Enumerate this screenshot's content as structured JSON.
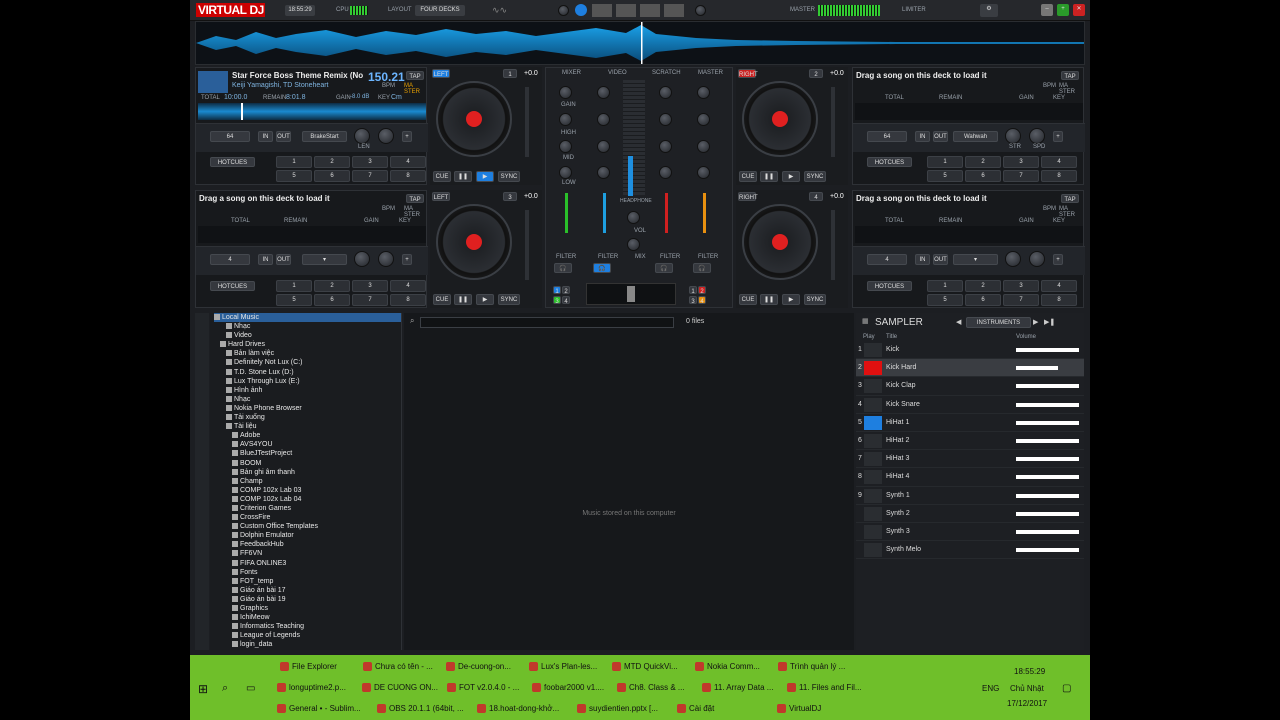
{
  "app": {
    "logo_a": "VIRTUAL",
    "logo_b": "DJ",
    "clock": "18:55:29",
    "cpu_label": "CPU",
    "layout_label": "LAYOUT",
    "layout_value": "FOUR DECKS",
    "master_label": "MASTER",
    "limiter_label": "LIMITER"
  },
  "deck1": {
    "title": "Star Force Boss Theme Remix (No",
    "artist": "Keiji Yamagishi, TD Stoneheart",
    "bpm": "150.21",
    "bpm_label": "BPM",
    "total_label": "TOTAL",
    "total": "10:00.0",
    "remain_label": "REMAIN",
    "remain": "8:01.8",
    "gain_label": "GAIN",
    "gain": "-8.0 dB",
    "key_label": "KEY",
    "key": "Cm",
    "tap": "TAP",
    "master": "MA STER",
    "loop": "64",
    "fx": "BrakeStart",
    "len": "LEN",
    "hotcues": "HOTCUES",
    "side": "LEFT",
    "num": "1",
    "pitch": "+0.0"
  },
  "deck2": {
    "title": "Drag a song on this deck to load it",
    "tap": "TAP",
    "bpm_label": "BPM",
    "master": "MA STER",
    "total_label": "TOTAL",
    "remain_label": "REMAIN",
    "gain_label": "GAIN",
    "key_label": "KEY",
    "loop": "64",
    "fx": "Wahwah",
    "str": "STR",
    "spd": "SPD",
    "hotcues": "HOTCUES",
    "side": "RIGHT",
    "num": "2",
    "pitch": "+0.0"
  },
  "deck3": {
    "title": "Drag a song on this deck to load it",
    "tap": "TAP",
    "bpm_label": "BPM",
    "master": "MA STER",
    "total_label": "TOTAL",
    "remain_label": "REMAIN",
    "gain_label": "GAIN",
    "key_label": "KEY",
    "loop": "4",
    "hotcues": "HOTCUES",
    "side": "LEFT",
    "num": "3",
    "pitch": "+0.0"
  },
  "deck4": {
    "title": "Drag a song on this deck to load it",
    "tap": "TAP",
    "bpm_label": "BPM",
    "master": "MA STER",
    "total_label": "TOTAL",
    "remain_label": "REMAIN",
    "gain_label": "GAIN",
    "key_label": "KEY",
    "loop": "4",
    "hotcues": "HOTCUES",
    "side": "RIGHT",
    "num": "4",
    "pitch": "+0.0"
  },
  "transport": {
    "cue": "CUE",
    "sync": "SYNC",
    "in": "IN",
    "out": "OUT",
    "loop": "LOOP",
    "pads": "PADS",
    "pct": "100%"
  },
  "pads": [
    "1",
    "2",
    "3",
    "4",
    "5",
    "6",
    "7",
    "8"
  ],
  "mixer": {
    "tabs": [
      "MIXER",
      "VIDEO",
      "SCRATCH",
      "MASTER"
    ],
    "gain": "GAIN",
    "high": "HIGH",
    "mid": "MID",
    "low": "LOW",
    "filter": "FILTER",
    "headphone": "HEADPHONE",
    "vol": "VOL",
    "mix": "MIX"
  },
  "browser": {
    "files": "0 files",
    "empty": "Music stored on this computer",
    "tree": [
      "Local Music",
      "Nhạc",
      "Video",
      "Hard Drives",
      "Bản làm việc",
      "Definitely Not Lux (C:)",
      "T.D. Stone Lux (D:)",
      "Lux Through Lux (E:)",
      "Hình ảnh",
      "Nhạc",
      "Nokia Phone Browser",
      "Tải xuống",
      "Tài liệu",
      "Adobe",
      "AVS4YOU",
      "BlueJTestProject",
      "BOOM",
      "Bản ghi âm thanh",
      "Champ",
      "COMP 102x Lab 03",
      "COMP 102x Lab 04",
      "Criterion Games",
      "CrossFire",
      "Custom Office Templates",
      "Dolphin Emulator",
      "FeedbackHub",
      "FF6VN",
      "FIFA ONLINE3",
      "Fonts",
      "FOT_temp",
      "Giáo án bài 17",
      "Giáo án bài 19",
      "Graphics",
      "IchiMeow",
      "Informatics Teaching",
      "League of Legends",
      "login_data"
    ]
  },
  "sampler": {
    "title": "SAMPLER",
    "bank": "INSTRUMENTS",
    "col_play": "Play",
    "col_title": "Title",
    "col_volume": "Volume",
    "rows": [
      {
        "n": "1",
        "title": "Kick",
        "vol": 1.0,
        "color": "#2a2d31"
      },
      {
        "n": "2",
        "title": "Kick Hard",
        "vol": 0.66,
        "color": "#e01010"
      },
      {
        "n": "3",
        "title": "Kick Clap",
        "vol": 1.0,
        "color": "#2a2d31"
      },
      {
        "n": "4",
        "title": "Kick Snare",
        "vol": 1.0,
        "color": "#2a2d31"
      },
      {
        "n": "5",
        "title": "HiHat 1",
        "vol": 1.0,
        "color": "#1e7fe0"
      },
      {
        "n": "6",
        "title": "HiHat 2",
        "vol": 1.0,
        "color": "#2a2d31"
      },
      {
        "n": "7",
        "title": "HiHat 3",
        "vol": 1.0,
        "color": "#2a2d31"
      },
      {
        "n": "8",
        "title": "HiHat 4",
        "vol": 1.0,
        "color": "#2a2d31"
      },
      {
        "n": "9",
        "title": "Synth 1",
        "vol": 1.0,
        "color": "#2a2d31"
      },
      {
        "n": "",
        "title": "Synth 2",
        "vol": 1.0,
        "color": "#2a2d31"
      },
      {
        "n": "",
        "title": "Synth 3",
        "vol": 1.0,
        "color": "#2a2d31"
      },
      {
        "n": "",
        "title": "Synth Melo",
        "vol": 1.0,
        "color": "#2a2d31"
      }
    ]
  },
  "taskbar": {
    "row1": [
      "File Explorer",
      "Chưa có tên - ...",
      "De-cuong-on...",
      "Lux's Plan-les...",
      "MTD QuickVi...",
      "Nokia Comm...",
      "Trình quản lý ..."
    ],
    "row2": [
      "longuptime2.p...",
      "DE CUONG ON...",
      "FOT v2.0.4.0 - ...",
      "foobar2000 v1....",
      "Ch8. Class & ...",
      "11. Array Data ...",
      "11. Files and Fil..."
    ],
    "row3": [
      "General • - Sublim...",
      "OBS 20.1.1 (64bit, ...",
      "18.hoat-dong-khở...",
      "suydientien.pptx [...",
      "Cài đặt",
      "VirtualDJ"
    ],
    "time": "18:55:29",
    "day": "Chủ Nhật",
    "date": "17/12/2017",
    "lang": "ENG"
  }
}
